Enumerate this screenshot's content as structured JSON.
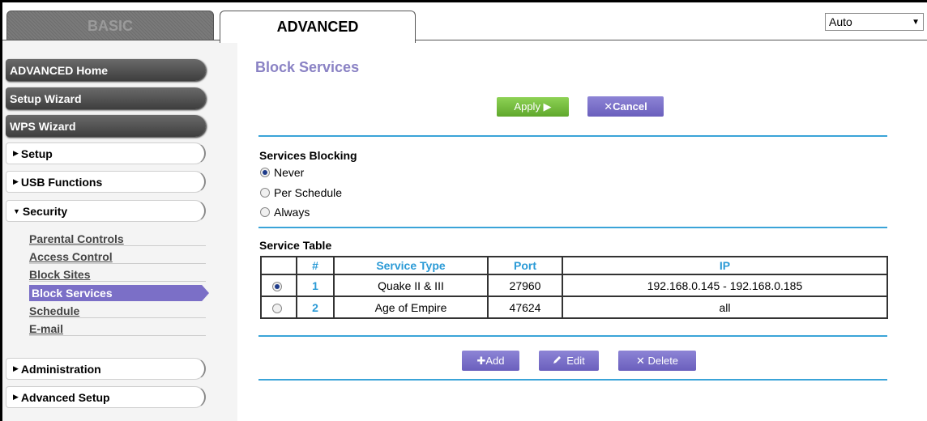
{
  "tabs": {
    "basic": "BASIC",
    "advanced": "ADVANCED"
  },
  "language": {
    "selected": "Auto",
    "arrow": "▼"
  },
  "sidebar": {
    "advanced_home": "ADVANCED Home",
    "setup_wizard": "Setup Wizard",
    "wps_wizard": "WPS Wizard",
    "setup": "Setup",
    "usb_functions": "USB Functions",
    "security": "Security",
    "security_items": {
      "parental_controls": "Parental Controls",
      "access_control": "Access Control",
      "block_sites": "Block Sites",
      "block_services": "Block Services",
      "schedule": "Schedule",
      "email": "E-mail"
    },
    "administration": "Administration",
    "advanced_setup": "Advanced Setup",
    "expand_glyph": "▶",
    "collapse_glyph": "▼"
  },
  "main": {
    "title": "Block Services",
    "apply_label": "Apply ▶",
    "cancel_label": "✕Cancel",
    "services_blocking": {
      "title": "Services Blocking",
      "options": [
        "Never",
        "Per Schedule",
        "Always"
      ],
      "selected": "Never"
    },
    "service_table": {
      "title": "Service Table",
      "headers": [
        "#",
        "Service Type",
        "Port",
        "IP"
      ],
      "rows": [
        {
          "num": "1",
          "service": "Quake II & III",
          "port": "27960",
          "ip": "192.168.0.145 - 192.168.0.185",
          "selected": true
        },
        {
          "num": "2",
          "service": "Age of Empire",
          "port": "47624",
          "ip": "all",
          "selected": false
        }
      ]
    },
    "add_label": "✚Add",
    "edit_label": "Edit",
    "delete_label": "✕ Delete"
  },
  "colors": {
    "accent_purple": "#7b6fc7",
    "title_purple": "#8a82c4",
    "divider_blue": "#3aa4d8",
    "apply_green": "#6cbf3a"
  }
}
